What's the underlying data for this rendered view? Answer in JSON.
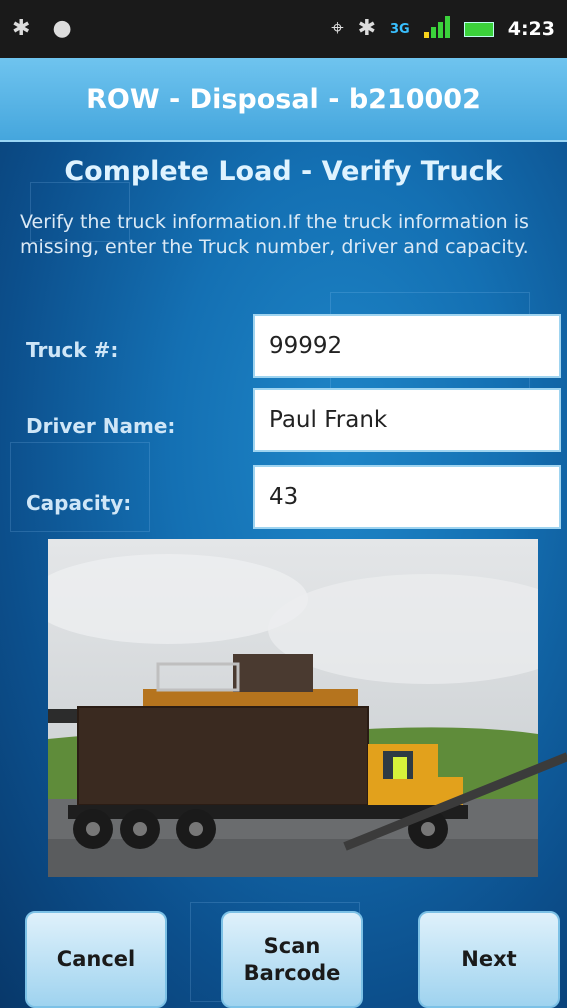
{
  "status_bar": {
    "left_icons": [
      "bluetooth-icon",
      "notification-icon"
    ],
    "right_icons": [
      "gps-icon",
      "bluetooth-icon",
      "network-3g-icon",
      "signal-icon",
      "battery-icon"
    ],
    "network_label": "3G",
    "time": "4:23"
  },
  "header": {
    "title": "ROW - Disposal - b210002"
  },
  "screen": {
    "subtitle": "Complete Load - Verify Truck",
    "instructions": "Verify the truck information.If the truck information is missing, enter the Truck number, driver and capacity."
  },
  "form": {
    "truck_label": "Truck #:",
    "truck_value": "99992",
    "driver_label": "Driver Name:",
    "driver_value": "Paul Frank",
    "capacity_label": "Capacity:",
    "capacity_value": "43"
  },
  "buttons": {
    "cancel": "Cancel",
    "scan": "Scan\nBarcode",
    "next": "Next"
  },
  "colors": {
    "title_bar": "#5bb8e8",
    "background": "#1470b3",
    "button": "#bfe3f6"
  }
}
